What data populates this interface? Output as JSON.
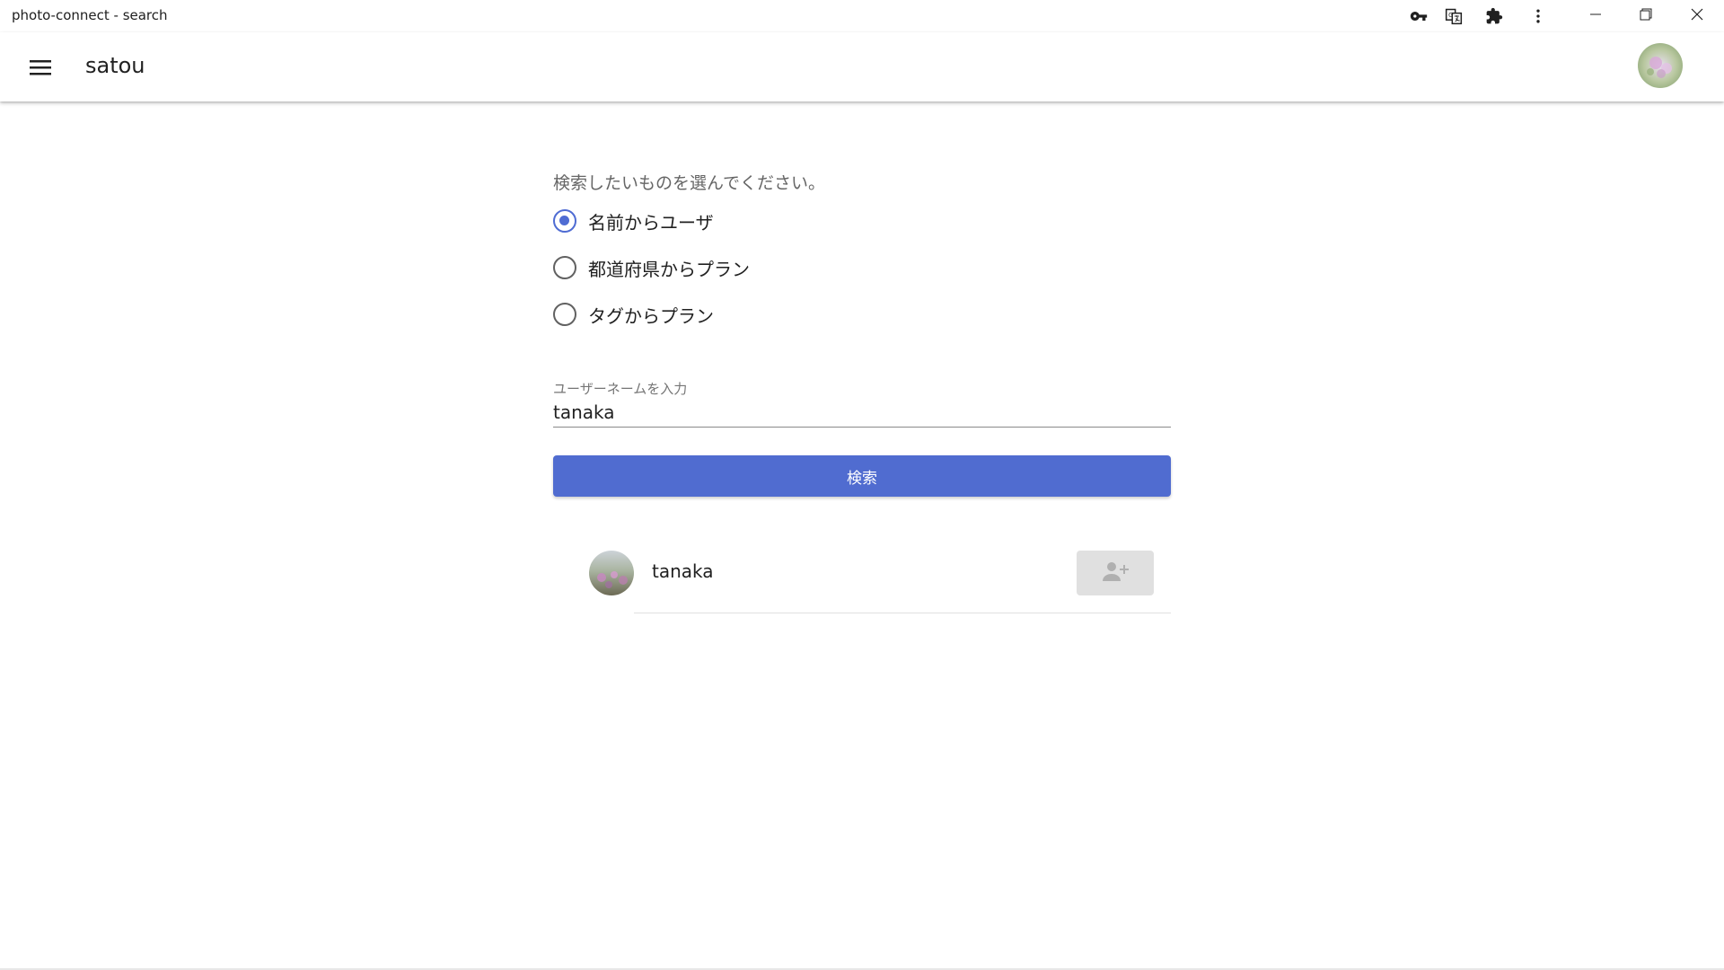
{
  "window": {
    "title": "photo-connect - search",
    "toolbar_icons": [
      "key-icon",
      "translate-icon",
      "extension-icon",
      "more-vert-icon"
    ],
    "controls": [
      "minimize-icon",
      "restore-icon",
      "close-icon"
    ]
  },
  "appbar": {
    "menu_icon": "hamburger-menu-icon",
    "title": "satou",
    "avatar": "user-avatar"
  },
  "search": {
    "prompt": "検索したいものを選んでください。",
    "options": [
      {
        "label": "名前からユーザ",
        "checked": true
      },
      {
        "label": "都道府県からプラン",
        "checked": false
      },
      {
        "label": "タグからプラン",
        "checked": false
      }
    ],
    "input_label": "ユーザーネームを入力",
    "input_value": "tanaka",
    "button_label": "検索"
  },
  "results": [
    {
      "name": "tanaka",
      "action_icon": "person-add-icon"
    }
  ],
  "colors": {
    "accent": "#506cd0",
    "disabled_button": "#e0e0e0"
  }
}
